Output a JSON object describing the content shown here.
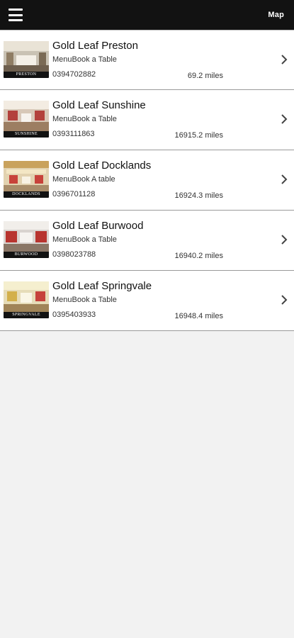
{
  "topbar": {
    "menu_icon": "hamburger-menu-icon",
    "map_label": "Map",
    "background": "#121212"
  },
  "restaurants": [
    {
      "name": "Gold Leaf Preston",
      "subtitle": "MenuBook a Table",
      "phone": "0394702882",
      "distance": "69.2 miles",
      "image_label": "PRESTON"
    },
    {
      "name": "Gold Leaf Sunshine",
      "subtitle": "MenuBook a Table",
      "phone": "0393111863",
      "distance": "16915.2 miles",
      "image_label": "SUNSHINE"
    },
    {
      "name": "Gold Leaf Docklands",
      "subtitle": "MenuBook A table",
      "phone": "0396701128",
      "distance": "16924.3 miles",
      "image_label": "DOCKLANDS"
    },
    {
      "name": "Gold Leaf Burwood",
      "subtitle": "MenuBook a Table",
      "phone": "0398023788",
      "distance": "16940.2 miles",
      "image_label": "BURWOOD"
    },
    {
      "name": "Gold Leaf Springvale",
      "subtitle": "MenuBook a Table",
      "phone": "0395403933",
      "distance": "16948.4 miles",
      "image_label": "SPRINGVALE"
    }
  ],
  "icons": {
    "row_chevron": "chevron-right-icon"
  }
}
